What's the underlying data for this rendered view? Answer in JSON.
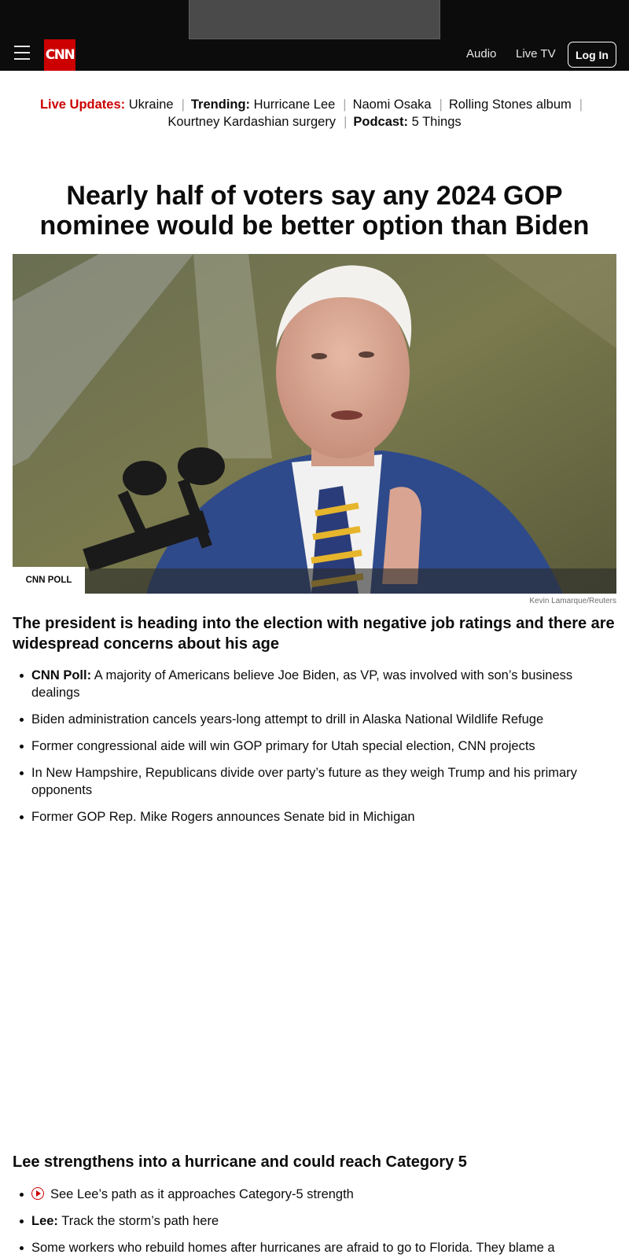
{
  "header": {
    "logo": "CNN",
    "nav": {
      "audio": "Audio",
      "live_tv": "Live TV"
    },
    "login_label": "Log In"
  },
  "trending": {
    "live_updates_label": "Live Updates:",
    "live_updates_item": "Ukraine",
    "trending_label": "Trending:",
    "items": [
      "Hurricane Lee",
      "Naomi Osaka",
      "Rolling Stones album",
      "Kourtney Kardashian surgery"
    ],
    "podcast_label": "Podcast:",
    "podcast_item": "5 Things"
  },
  "lead_story": {
    "headline": "Nearly half of voters say any 2024 GOP nominee would be better option than Biden",
    "image_badge": "CNN POLL",
    "image_credit": "Kevin Lamarque/Reuters",
    "subheadline": "The president is heading into the election with negative job ratings and there are widespread concerns about his age",
    "bullets": [
      {
        "bold": "CNN Poll:",
        "text": "A majority of Americans believe Joe Biden, as VP, was involved with son’s business dealings"
      },
      {
        "bold": "",
        "text": "Biden administration cancels years-long attempt to drill in Alaska National Wildlife Refuge"
      },
      {
        "bold": "",
        "text": "Former congressional aide will win GOP primary for Utah special election, CNN projects"
      },
      {
        "bold": "",
        "text": "In New Hampshire, Republicans divide over party’s future as they weigh Trump and his primary opponents"
      },
      {
        "bold": "",
        "text": "Former GOP Rep. Mike Rogers announces Senate bid in Michigan"
      }
    ]
  },
  "second_story": {
    "headline": "Lee strengthens into a hurricane and could reach Category 5",
    "bullets": [
      {
        "icon": "video-play-icon",
        "bold": "",
        "text": "See Lee’s path as it approaches Category-5 strength"
      },
      {
        "bold": "Lee:",
        "text": "Track the storm’s path here"
      },
      {
        "bold": "",
        "text": "Some workers who rebuild homes after hurricanes are afraid to go to Florida. They blame a"
      }
    ]
  },
  "colors": {
    "brand_red": "#cc0000",
    "topbar": "#0c0c0c"
  }
}
